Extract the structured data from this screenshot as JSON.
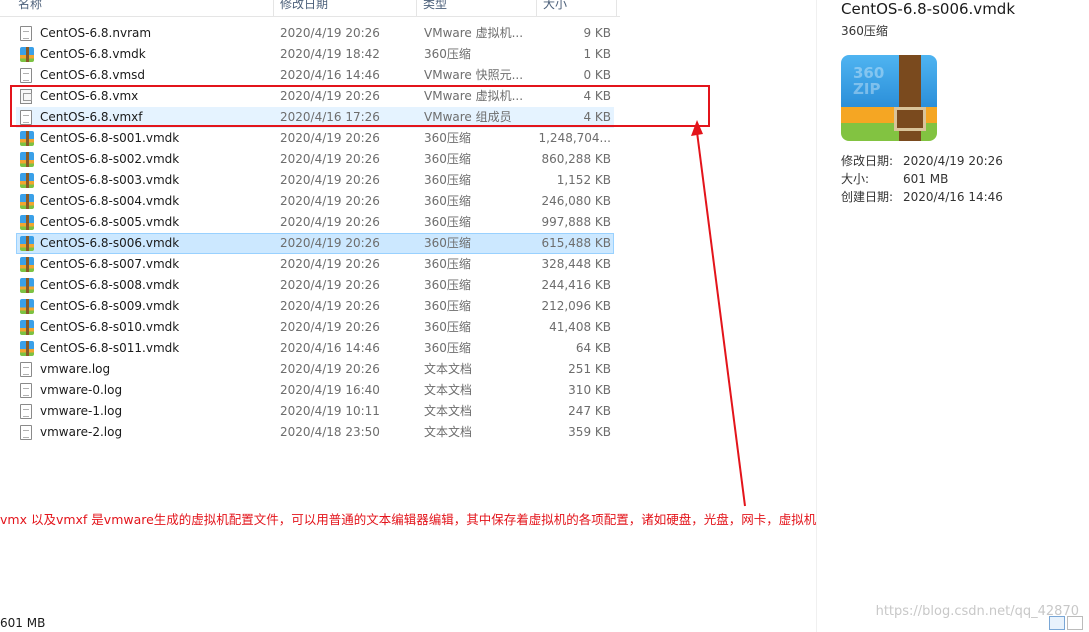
{
  "columns": {
    "name": "名称",
    "date": "修改日期",
    "type": "类型",
    "size": "大小"
  },
  "files": [
    {
      "name": "CentOS-6.8.nvram",
      "date": "2020/4/19 20:26",
      "type": "VMware 虚拟机...",
      "size": "9 KB",
      "icon": "document-icon"
    },
    {
      "name": "CentOS-6.8.vmdk",
      "date": "2020/4/19 18:42",
      "type": "360压缩",
      "size": "1 KB",
      "icon": "archive-icon"
    },
    {
      "name": "CentOS-6.8.vmsd",
      "date": "2020/4/16 14:46",
      "type": "VMware 快照元...",
      "size": "0 KB",
      "icon": "document-icon"
    },
    {
      "name": "CentOS-6.8.vmx",
      "date": "2020/4/19 20:26",
      "type": "VMware 虚拟机...",
      "size": "4 KB",
      "icon": "vm-config-icon"
    },
    {
      "name": "CentOS-6.8.vmxf",
      "date": "2020/4/16 17:26",
      "type": "VMware 组成员",
      "size": "4 KB",
      "icon": "document-icon"
    },
    {
      "name": "CentOS-6.8-s001.vmdk",
      "date": "2020/4/19 20:26",
      "type": "360压缩",
      "size": "1,248,704...",
      "icon": "archive-icon"
    },
    {
      "name": "CentOS-6.8-s002.vmdk",
      "date": "2020/4/19 20:26",
      "type": "360压缩",
      "size": "860,288 KB",
      "icon": "archive-icon"
    },
    {
      "name": "CentOS-6.8-s003.vmdk",
      "date": "2020/4/19 20:26",
      "type": "360压缩",
      "size": "1,152 KB",
      "icon": "archive-icon"
    },
    {
      "name": "CentOS-6.8-s004.vmdk",
      "date": "2020/4/19 20:26",
      "type": "360压缩",
      "size": "246,080 KB",
      "icon": "archive-icon"
    },
    {
      "name": "CentOS-6.8-s005.vmdk",
      "date": "2020/4/19 20:26",
      "type": "360压缩",
      "size": "997,888 KB",
      "icon": "archive-icon"
    },
    {
      "name": "CentOS-6.8-s006.vmdk",
      "date": "2020/4/19 20:26",
      "type": "360压缩",
      "size": "615,488 KB",
      "icon": "archive-icon"
    },
    {
      "name": "CentOS-6.8-s007.vmdk",
      "date": "2020/4/19 20:26",
      "type": "360压缩",
      "size": "328,448 KB",
      "icon": "archive-icon"
    },
    {
      "name": "CentOS-6.8-s008.vmdk",
      "date": "2020/4/19 20:26",
      "type": "360压缩",
      "size": "244,416 KB",
      "icon": "archive-icon"
    },
    {
      "name": "CentOS-6.8-s009.vmdk",
      "date": "2020/4/19 20:26",
      "type": "360压缩",
      "size": "212,096 KB",
      "icon": "archive-icon"
    },
    {
      "name": "CentOS-6.8-s010.vmdk",
      "date": "2020/4/19 20:26",
      "type": "360压缩",
      "size": "41,408 KB",
      "icon": "archive-icon"
    },
    {
      "name": "CentOS-6.8-s011.vmdk",
      "date": "2020/4/16 14:46",
      "type": "360压缩",
      "size": "64 KB",
      "icon": "archive-icon"
    },
    {
      "name": "vmware.log",
      "date": "2020/4/19 20:26",
      "type": "文本文档",
      "size": "251 KB",
      "icon": "document-icon"
    },
    {
      "name": "vmware-0.log",
      "date": "2020/4/19 16:40",
      "type": "文本文档",
      "size": "310 KB",
      "icon": "document-icon"
    },
    {
      "name": "vmware-1.log",
      "date": "2020/4/19 10:11",
      "type": "文本文档",
      "size": "247 KB",
      "icon": "document-icon"
    },
    {
      "name": "vmware-2.log",
      "date": "2020/4/18 23:50",
      "type": "文本文档",
      "size": "359 KB",
      "icon": "document-icon"
    }
  ],
  "selected_index": 10,
  "hover_index": 4,
  "preview": {
    "title": "CentOS-6.8-s006.vmdk",
    "type": "360压缩",
    "icon_text": "360\nZIP",
    "modified_label": "修改日期:",
    "modified_value": "2020/4/19 20:26",
    "size_label": "大小:",
    "size_value": "601 MB",
    "created_label": "创建日期:",
    "created_value": "2020/4/16 14:46"
  },
  "annotation": "vmx 以及vmxf 是vmware生成的虚拟机配置文件，可以用普通的文本编辑器编辑，其中保存着虚拟机的各项配置，诸如硬盘，光盘，网卡，虚拟机名等配置信息都保存其中",
  "status_bar": {
    "selection_size": "601 MB"
  },
  "watermark": "https://blog.csdn.net/qq_42870",
  "colors": {
    "annotation_red": "#e3141b",
    "selection": "#cce8ff",
    "hover": "#e5f3ff"
  }
}
